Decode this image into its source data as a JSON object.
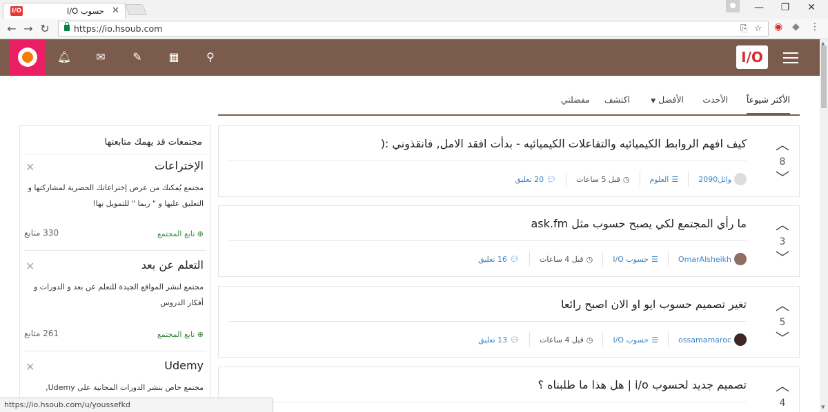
{
  "browser": {
    "tab_title": "حسوب I/O",
    "tab_favicon": "I/O",
    "url": "https://io.hsoub.com",
    "status_url": "https://io.hsoub.com/u/youssefkd"
  },
  "site": {
    "logo_text": "I/O",
    "colors": {
      "header": "#7b5b4b",
      "avatar_bg": "#e91e63",
      "link": "#3d85c6",
      "follow": "#3a8b3a"
    },
    "icons": [
      "notifications-bell-icon",
      "messages-envelope-icon",
      "new-post-pencil-icon",
      "communities-grid-icon",
      "search-icon",
      "menu-hamburger-icon"
    ]
  },
  "tabs": [
    {
      "label": "الأكثر شيوعاً"
    },
    {
      "label": "الأحدث"
    },
    {
      "label": "الأفضل"
    },
    {
      "label": "اكتشف"
    },
    {
      "label": "مفضلتي"
    }
  ],
  "posts": [
    {
      "votes": "8",
      "title": "كيف افهم الروابط الكيميائيه والتفاعلات الكيميائيه - بدأت افقد الامل, فانقذوني :(",
      "author": "وائل2090",
      "category": "العلوم",
      "time": "قبل 5 ساعات",
      "comments": "20 تعليق"
    },
    {
      "votes": "3",
      "title": "ما رأي المجتمع لكي يصبح حسوب مثل ask.fm",
      "author": "OmarAlsheikh",
      "category": "حسوب I/O",
      "time": "قبل 4 ساعات",
      "comments": "16 تعليق"
    },
    {
      "votes": "5",
      "title": "تغير تصميم حسوب ايو او الان اصبح رائعا",
      "author": "ossamamaroc",
      "category": "حسوب I/O",
      "time": "قبل 4 ساعات",
      "comments": "13 تعليق"
    },
    {
      "votes": "4",
      "title": "تصميم جديد لحسوب i/o | هل هذا ما طلبناه ؟"
    }
  ],
  "sidebar": {
    "title": "مجتمعات قد يهمك متابعتها",
    "communities": [
      {
        "name": "الإختراعات",
        "description": "مجتمع يُمكنك من عرض إختراعاتك الحصرية لمشاركتها و التعليق عليها و \" ربما \" للتمويل بها!",
        "follow": "تابع المجتمع",
        "followers": "330 متابع"
      },
      {
        "name": "التعلم عن بعد",
        "description": "مجتمع لنشر المواقع الجيدة للتعلم عن بعد و الدورات و أفكار الدروس",
        "follow": "تابع المجتمع",
        "followers": "261 متابع"
      },
      {
        "name": "Udemy",
        "description": "مجتمع خاص بنشر الدورات المجانية على Udemy,"
      }
    ]
  }
}
